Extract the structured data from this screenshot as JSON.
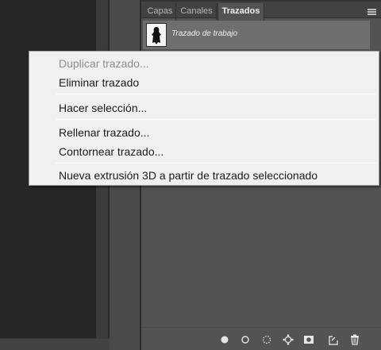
{
  "panel": {
    "tabs": [
      {
        "label": "Capas",
        "active": false
      },
      {
        "label": "Canales",
        "active": false
      },
      {
        "label": "Trazados",
        "active": true
      }
    ],
    "menu_icon": "hamburger-icon",
    "paths": [
      {
        "name": "Trazado de trabajo",
        "selected": true
      }
    ],
    "bottom_icons": [
      "fill-path-icon",
      "stroke-path-icon",
      "load-selection-icon",
      "make-work-path-icon",
      "add-mask-icon",
      "new-path-icon",
      "delete-icon"
    ]
  },
  "context_menu": {
    "items": [
      {
        "label": "Duplicar trazado...",
        "enabled": false
      },
      {
        "label": "Eliminar trazado",
        "enabled": true
      },
      {
        "label": "Hacer selección...",
        "enabled": true
      },
      {
        "label": "Rellenar trazado...",
        "enabled": true
      },
      {
        "label": "Contornear trazado...",
        "enabled": true
      },
      {
        "label": "Nueva extrusión 3D a partir de trazado seleccionado",
        "enabled": true
      }
    ]
  },
  "colors": {
    "panel_bg": "#535353",
    "selected_row": "#6e6e6e",
    "menu_bg": "#f0f0f0",
    "disabled_text": "#8d8d8d"
  }
}
